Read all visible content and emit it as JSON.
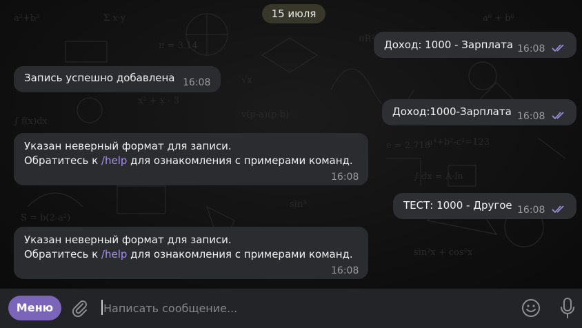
{
  "date_separator": "15 июля",
  "messages": [
    {
      "text": "Доход: 1000 - Зарплата",
      "time": "16:08"
    },
    {
      "text": "Запись успешно добавлена",
      "time": "16:08"
    },
    {
      "text": "Доход:1000-Зарплата",
      "time": "16:08"
    },
    {
      "line1": "Указан неверный формат для записи.",
      "pre": "Обратитесь к ",
      "link": "/help",
      "post": " для ознакомления с примерами команд.",
      "time": "16:08"
    },
    {
      "text": "ТЕСТ: 1000 - Другое",
      "time": "16:08"
    },
    {
      "line1": "Указан неверный формат для записи.",
      "pre": "Обратитесь к ",
      "link": "/help",
      "post": " для ознакомления с примерами команд.",
      "time": "16:08"
    }
  ],
  "input": {
    "menu_label": "Меню",
    "placeholder": "Написать сообщение...",
    "icons": [
      "paperclip-icon",
      "emoji-icon",
      "microphone-icon"
    ]
  },
  "colors": {
    "accent": "#7b65b8",
    "link": "#a58ef0",
    "read_ticks": "#9e94e0"
  }
}
